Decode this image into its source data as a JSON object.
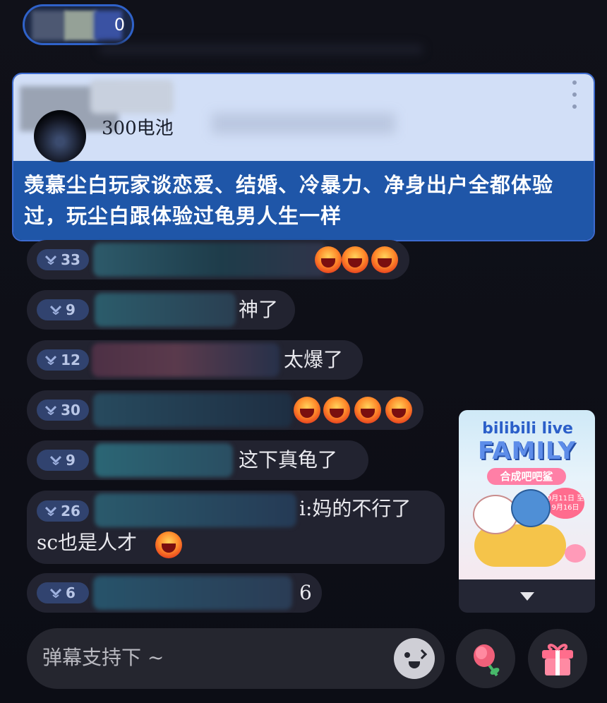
{
  "top_user": {
    "tail_text": "0"
  },
  "superchat": {
    "price": "300电池",
    "message": "羡慕尘白玩家谈恋爱、结婚、冷暴力、净身出户全都体验过，玩尘白跟体验过龟男人生一样"
  },
  "danmaku": [
    {
      "level": "33",
      "text": ""
    },
    {
      "level": "9",
      "text": "神了"
    },
    {
      "level": "12",
      "text": "太爆了"
    },
    {
      "level": "30",
      "text": ""
    },
    {
      "level": "9",
      "text": "这下真龟了"
    },
    {
      "level": "26",
      "text": "i:妈的不行了",
      "text2": "sc也是人才"
    },
    {
      "level": "6",
      "text": "6"
    }
  ],
  "promo": {
    "line1": "bilibili live",
    "line2": "FAMILY",
    "line3": "合成吧吧鲨",
    "date": "9月11日 至9月16日"
  },
  "input": {
    "placeholder": "弹幕支持下 ~"
  },
  "colors": {
    "background": "#0f1018",
    "superchat_header": "#d2dff7",
    "superchat_body": "#1f56a8",
    "badge": "#31436f",
    "row_bg": "#222330"
  },
  "icons": [
    "emoji-face-icon",
    "rose-gift-icon",
    "gift-box-icon",
    "chevron-down-icon",
    "fan-medal-chevron-icon",
    "more-vertical-icon"
  ]
}
